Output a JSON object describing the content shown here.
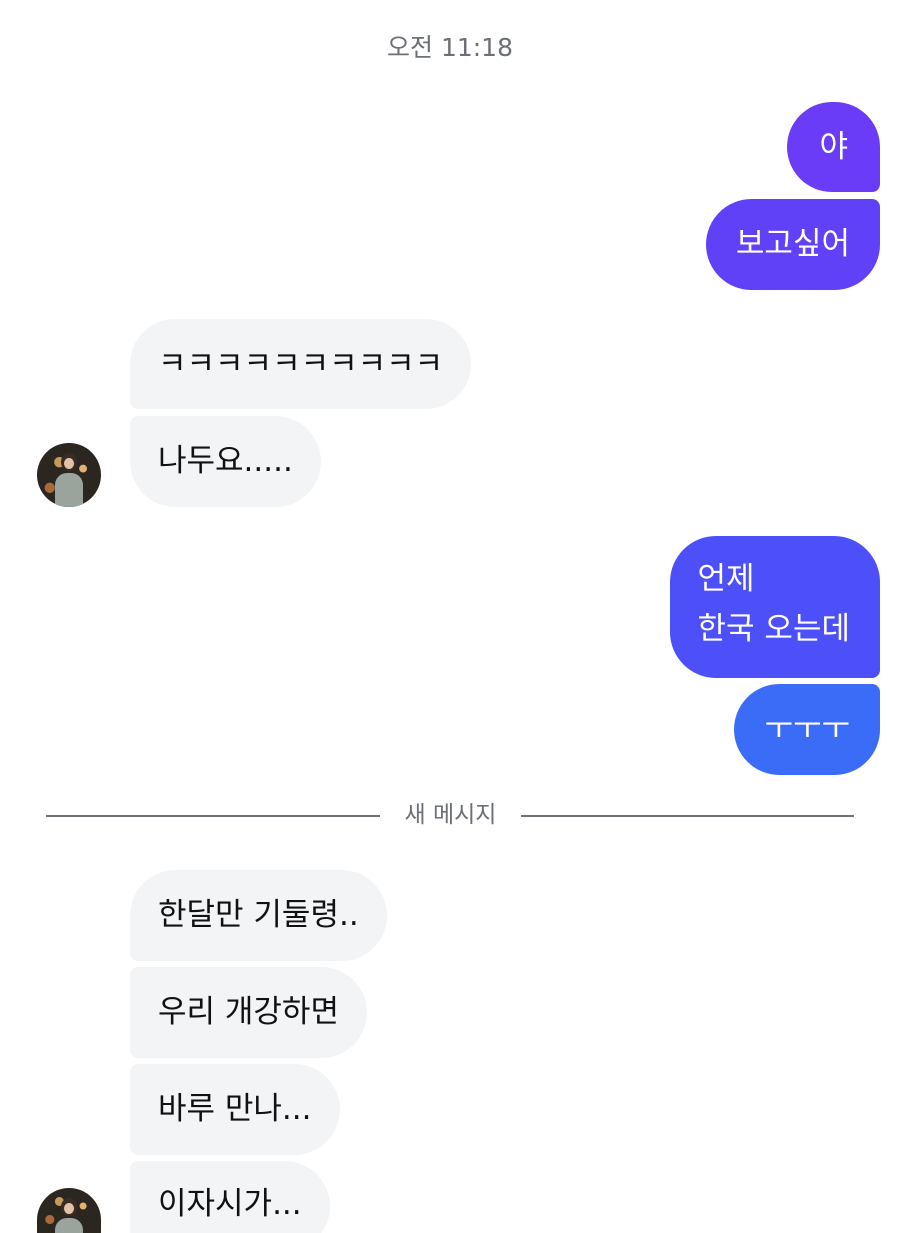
{
  "timestamp": "오전 11:18",
  "divider_label": "새 메시지",
  "messages_group1_out": [
    "야",
    "보고싶어"
  ],
  "messages_group2_in": [
    "ㅋㅋㅋㅋㅋㅋㅋㅋㅋㅋ",
    "나두요....."
  ],
  "messages_group3_out": [
    "언제",
    "한국 오는데",
    "ㅜㅜㅜ"
  ],
  "messages_group4_in": [
    "한달만 기둘령..",
    "우리 개강하면",
    "바루 만나...",
    "이자시가..."
  ],
  "colors": {
    "outgoing_purple": "#6a3cf7",
    "outgoing_indigo": "#4d4ff8",
    "outgoing_blue": "#3b6cf8",
    "incoming_bg": "#f3f4f6",
    "meta_text": "#6b6f76"
  },
  "icons": {
    "avatar": "profile-photo"
  }
}
